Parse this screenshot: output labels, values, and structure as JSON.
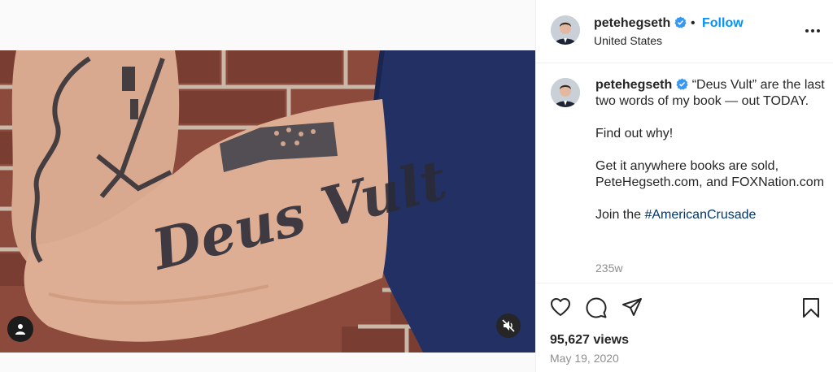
{
  "post": {
    "username": "petehegseth",
    "follow_label": "Follow",
    "separator": "•",
    "location": "United States",
    "caption": {
      "username": "petehegseth",
      "line1": "“Deus Vult” are the last two words of my book — out TODAY.",
      "line2": "Find out why!",
      "line3": "Get it anywhere books are sold, PeteHegseth.com, and FOXNation.com",
      "line4_prefix": "Join the ",
      "hashtag": "#AmericanCrusade"
    },
    "age": "235w",
    "views": "95,627 views",
    "date": "May 19, 2020",
    "tattoo_text": "Deus Vult"
  },
  "icons": {
    "verified": "verified-badge-icon",
    "more": "more-options-icon",
    "like": "heart-icon",
    "comment": "comment-icon",
    "share": "share-icon",
    "save": "bookmark-icon",
    "mute": "muted-speaker-icon",
    "tag": "user-tag-icon"
  },
  "colors": {
    "accent": "#0095f6",
    "hashtag": "#00376b",
    "secondary_text": "#8e8e8e",
    "verified": "#3897f0"
  }
}
